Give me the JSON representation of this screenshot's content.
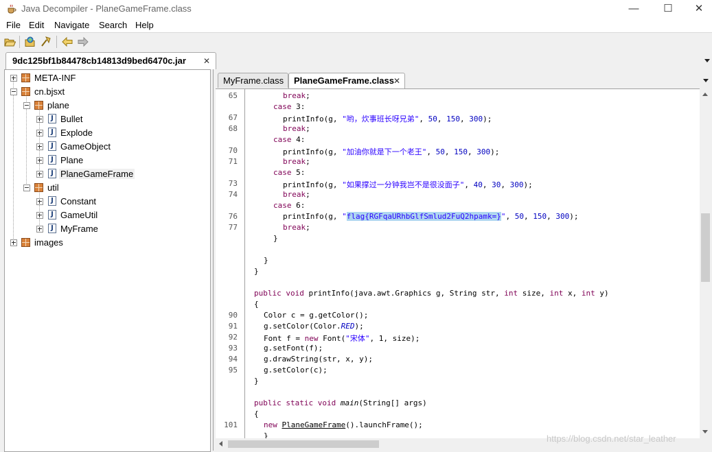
{
  "window": {
    "title": "Java Decompiler - PlaneGameFrame.class",
    "minimize_glyph": "—",
    "maximize_glyph": "☐",
    "close_glyph": "✕"
  },
  "menu": [
    "File",
    "Edit",
    "Navigate",
    "Search",
    "Help"
  ],
  "toolbar": {
    "icons": [
      "open-file-icon",
      "open-type-icon",
      "search-icon",
      "back-arrow-icon",
      "forward-arrow-icon"
    ]
  },
  "outer_tab": {
    "label": "9dc125bf1b84478cb14813d9bed6470c.jar",
    "close": "✕"
  },
  "tree": [
    {
      "label": "META-INF",
      "type": "package",
      "expander": "plus"
    },
    {
      "label": "cn.bjsxt",
      "type": "package",
      "expander": "minus"
    },
    {
      "label": "plane",
      "type": "package",
      "expander": "minus"
    },
    {
      "label": "Bullet",
      "type": "class",
      "expander": "plus"
    },
    {
      "label": "Explode",
      "type": "class",
      "expander": "plus"
    },
    {
      "label": "GameObject",
      "type": "class",
      "expander": "plus"
    },
    {
      "label": "Plane",
      "type": "class",
      "expander": "plus"
    },
    {
      "label": "PlaneGameFrame",
      "type": "class",
      "expander": "plus",
      "selected": true
    },
    {
      "label": "util",
      "type": "package",
      "expander": "minus"
    },
    {
      "label": "Constant",
      "type": "class",
      "expander": "plus"
    },
    {
      "label": "GameUtil",
      "type": "class",
      "expander": "plus"
    },
    {
      "label": "MyFrame",
      "type": "class",
      "expander": "plus"
    },
    {
      "label": "images",
      "type": "package",
      "expander": "plus"
    }
  ],
  "class_icon_glyph": "J",
  "editor_tabs": [
    {
      "label": "MyFrame.class",
      "active": false
    },
    {
      "label": "PlaneGameFrame.class",
      "active": true,
      "close": "✕"
    }
  ],
  "code": {
    "lines": {
      "65": "65",
      "67": "67",
      "68": "68",
      "70": "70",
      "71": "71",
      "73": "73",
      "74": "74",
      "76": "76",
      "77": "77",
      "90": "90",
      "91": "91",
      "92": "92",
      "93": "93",
      "94": "94",
      "95": "95",
      "101": "101"
    },
    "text": {
      "break": "break",
      "case": "case",
      "n3": "3",
      "n4": "4",
      "n5": "5",
      "n6": "6",
      "printInfo_g": "printInfo(g, ",
      "s3": "\"哟，炊事班长呀兄弟\"",
      "s4": "\"加油你就是下一个老王\"",
      "s5": "\"如果撑过一分钟我岂不是很没面子\"",
      "q": "\"",
      "flag": "flag{RGFqaURhbGlfSmlud2FuQ2hpamk=}",
      "a50": "50",
      "a150": "150",
      "a300": "300",
      "a40": "40",
      "a30": "30",
      "comma": ", ",
      "close": ");",
      "brace_close": "}",
      "brace_open": "{",
      "public": "public",
      "void": "void",
      "static": "static",
      "int": "int",
      "new": "new",
      "printInfo_sig_a": "printInfo(java.awt.Graphics g, String str, ",
      "size_c": " size, ",
      "x_c": " x, ",
      "y_c": " y)",
      "color_line": "Color c = g.getColor();",
      "setcolor_a": "g.setColor(Color.",
      "RED": "RED",
      "font_a": "Font f = ",
      "font_b": " Font(",
      "songti": "\"宋体\"",
      "font_c": ", 1, size);",
      "setfont": "g.setFont(f);",
      "drawstring": "g.drawString(str, x, y);",
      "setcolor_c": "g.setColor(c);",
      "main": "main",
      "main_args": "(String[] args)",
      "PlaneGameFrame": "PlaneGameFrame",
      "launch": "().launchFrame();"
    }
  },
  "watermark": "https://blog.csdn.net/star_leather"
}
